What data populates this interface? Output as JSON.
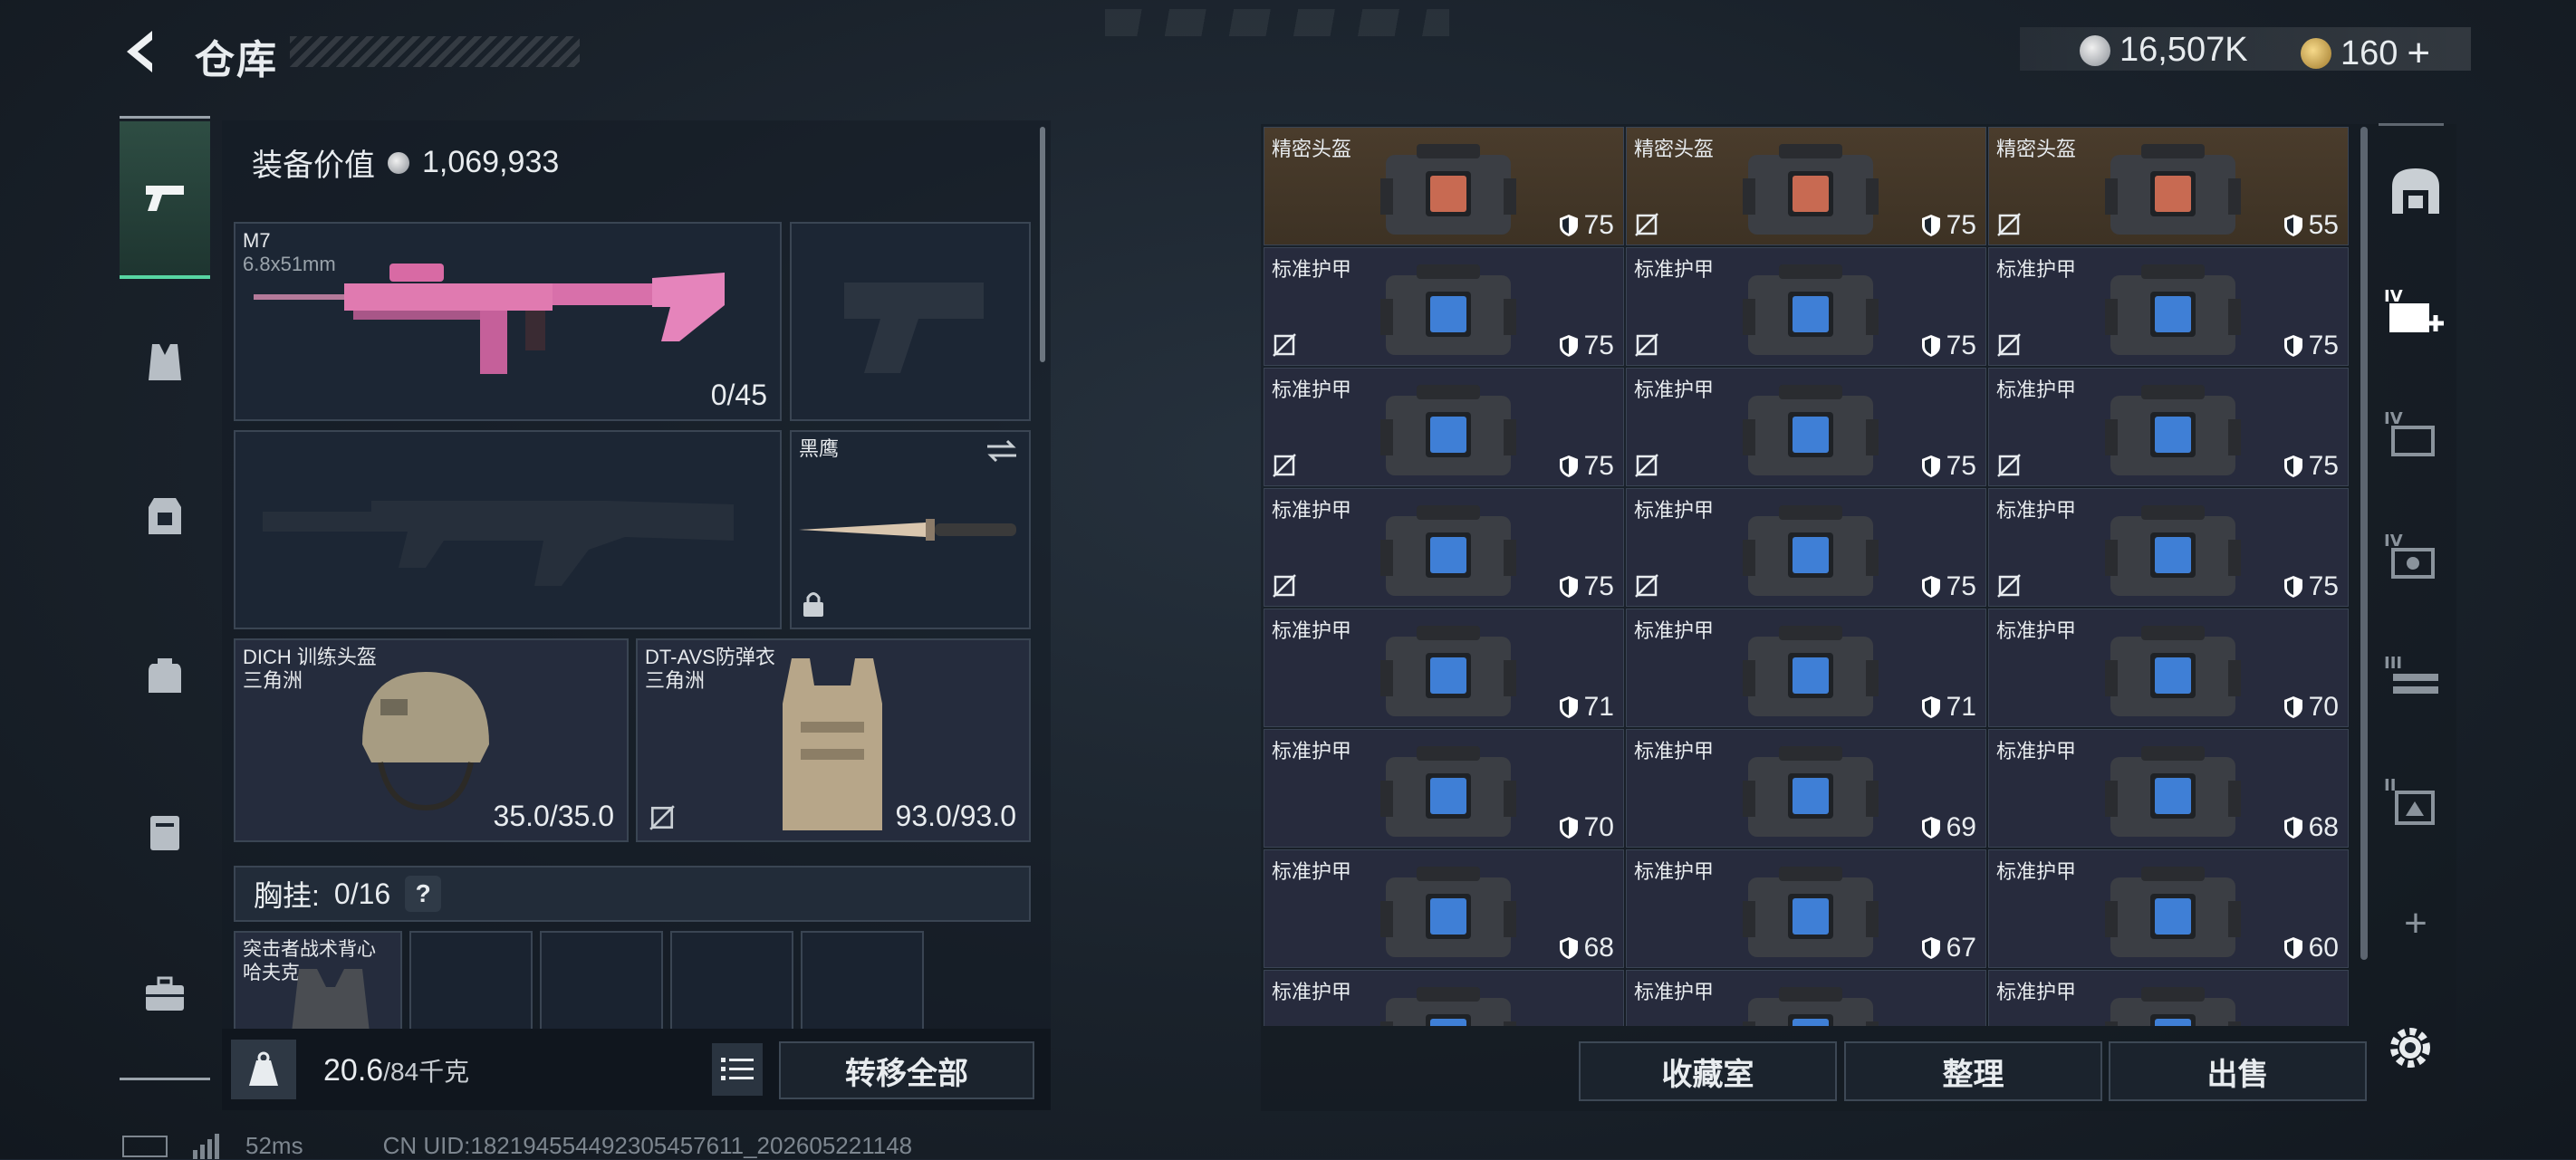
{
  "header": {
    "title": "仓库"
  },
  "currency": {
    "silver": "16,507K",
    "gold": "160",
    "gold_plus": "+"
  },
  "equipment": {
    "value_label": "装备价值",
    "value": "1,069,933",
    "primary_weapon": {
      "name": "M7",
      "caliber": "6.8x51mm",
      "ammo": "0/45"
    },
    "knife": {
      "name": "黑鹰"
    },
    "helmet": {
      "name": "DICH 训练头盔",
      "origin": "三角洲",
      "durability": "35.0/35.0"
    },
    "armor": {
      "name": "DT-AVS防弹衣",
      "origin": "三角洲",
      "durability": "93.0/93.0"
    },
    "chest_rig": {
      "label": "胸挂:",
      "capacity": "0/16",
      "help": "?"
    },
    "backpack": {
      "name": "突击者战术背心",
      "origin": "哈夫克"
    },
    "weight": {
      "current": "20.6",
      "max": "/84千克"
    },
    "transfer_all": "转移全部"
  },
  "inventory": {
    "rows": [
      [
        {
          "name": "精密头盔",
          "dur": "75",
          "gold": true,
          "nb": false
        },
        {
          "name": "精密头盔",
          "dur": "75",
          "gold": true,
          "nb": true
        },
        {
          "name": "精密头盔",
          "dur": "55",
          "gold": true,
          "nb": true
        }
      ],
      [
        {
          "name": "标准护甲",
          "dur": "75",
          "nb": true
        },
        {
          "name": "标准护甲",
          "dur": "75",
          "nb": true
        },
        {
          "name": "标准护甲",
          "dur": "75",
          "nb": true
        }
      ],
      [
        {
          "name": "标准护甲",
          "dur": "75",
          "nb": true
        },
        {
          "name": "标准护甲",
          "dur": "75",
          "nb": true
        },
        {
          "name": "标准护甲",
          "dur": "75",
          "nb": true
        }
      ],
      [
        {
          "name": "标准护甲",
          "dur": "75",
          "nb": true
        },
        {
          "name": "标准护甲",
          "dur": "75",
          "nb": true
        },
        {
          "name": "标准护甲",
          "dur": "75",
          "nb": true
        }
      ],
      [
        {
          "name": "标准护甲",
          "dur": "71",
          "nb": false
        },
        {
          "name": "标准护甲",
          "dur": "71",
          "nb": false
        },
        {
          "name": "标准护甲",
          "dur": "70",
          "nb": false
        }
      ],
      [
        {
          "name": "标准护甲",
          "dur": "70",
          "nb": false
        },
        {
          "name": "标准护甲",
          "dur": "69",
          "nb": false
        },
        {
          "name": "标准护甲",
          "dur": "68",
          "nb": false
        }
      ],
      [
        {
          "name": "标准护甲",
          "dur": "68",
          "nb": false
        },
        {
          "name": "标准护甲",
          "dur": "67",
          "nb": false
        },
        {
          "name": "标准护甲",
          "dur": "60",
          "nb": false
        }
      ],
      [
        {
          "name": "标准护甲",
          "dur": "",
          "nb": false
        },
        {
          "name": "标准护甲",
          "dur": "",
          "nb": false
        },
        {
          "name": "标准护甲",
          "dur": "",
          "nb": false
        }
      ]
    ],
    "buttons": {
      "collection": "收藏室",
      "organize": "整理",
      "sell": "出售"
    },
    "tab_labels": [
      "IV",
      "IV",
      "IV",
      "III",
      "II"
    ],
    "add_tab": "+"
  },
  "status": {
    "ping": "52ms",
    "uid": "CN UID:1821945544923054576​11_202605221148"
  }
}
